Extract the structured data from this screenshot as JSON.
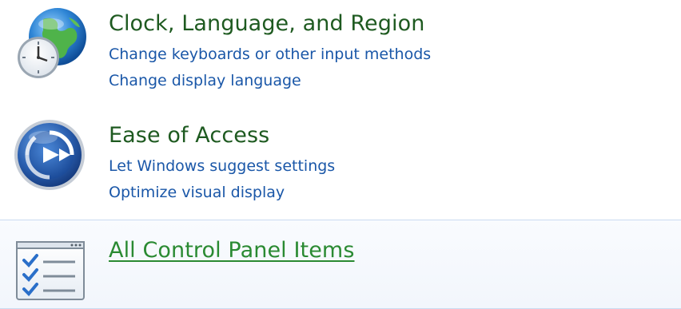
{
  "categories": [
    {
      "title": "Clock, Language, and Region",
      "icon": "clock-globe-icon",
      "tasks": [
        "Change keyboards or other input methods",
        "Change display language"
      ]
    },
    {
      "title": "Ease of Access",
      "icon": "ease-of-access-icon",
      "tasks": [
        "Let Windows suggest settings",
        "Optimize visual display"
      ]
    },
    {
      "title": "All Control Panel Items",
      "icon": "checklist-icon",
      "tasks": []
    }
  ],
  "colors": {
    "category_title": "#1e5a20",
    "category_link_hover": "#2a8a32",
    "task_link": "#1a57a8",
    "highlight_border": "#c9dbf1"
  }
}
